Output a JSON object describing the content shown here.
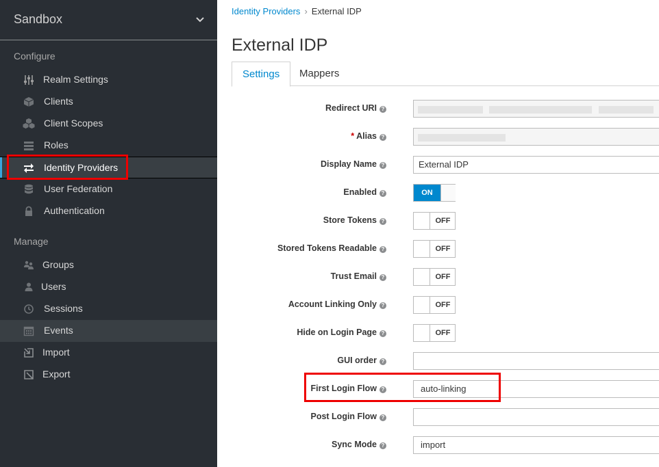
{
  "sidebar": {
    "realm": "Sandbox",
    "sections": {
      "configure": "Configure",
      "manage": "Manage"
    },
    "configure_items": [
      {
        "label": "Realm Settings",
        "icon": "sliders-icon"
      },
      {
        "label": "Clients",
        "icon": "cube-icon"
      },
      {
        "label": "Client Scopes",
        "icon": "cubes-icon"
      },
      {
        "label": "Roles",
        "icon": "list-icon"
      },
      {
        "label": "Identity Providers",
        "icon": "exchange-icon"
      },
      {
        "label": "User Federation",
        "icon": "database-icon"
      },
      {
        "label": "Authentication",
        "icon": "lock-icon"
      }
    ],
    "manage_items": [
      {
        "label": "Groups",
        "icon": "users-icon"
      },
      {
        "label": "Users",
        "icon": "user-icon"
      },
      {
        "label": "Sessions",
        "icon": "clock-icon"
      },
      {
        "label": "Events",
        "icon": "calendar-icon"
      },
      {
        "label": "Import",
        "icon": "import-icon"
      },
      {
        "label": "Export",
        "icon": "export-icon"
      }
    ],
    "active_item": "Identity Providers"
  },
  "breadcrumb": {
    "parent": "Identity Providers",
    "separator": "›",
    "current": "External IDP"
  },
  "page_title": "External IDP",
  "tabs": [
    {
      "label": "Settings",
      "active": true
    },
    {
      "label": "Mappers",
      "active": false
    }
  ],
  "form": {
    "redirect_uri": {
      "label": "Redirect URI"
    },
    "alias": {
      "label": "Alias",
      "required_mark": "*"
    },
    "display_name": {
      "label": "Display Name",
      "value": "External IDP"
    },
    "enabled": {
      "label": "Enabled",
      "state": "ON"
    },
    "store_tokens": {
      "label": "Store Tokens",
      "state": "OFF"
    },
    "stored_tokens_readable": {
      "label": "Stored Tokens Readable",
      "state": "OFF"
    },
    "trust_email": {
      "label": "Trust Email",
      "state": "OFF"
    },
    "account_linking_only": {
      "label": "Account Linking Only",
      "state": "OFF"
    },
    "hide_on_login_page": {
      "label": "Hide on Login Page",
      "state": "OFF"
    },
    "gui_order": {
      "label": "GUI order",
      "value": ""
    },
    "first_login_flow": {
      "label": "First Login Flow",
      "value": "auto-linking"
    },
    "post_login_flow": {
      "label": "Post Login Flow",
      "value": ""
    },
    "sync_mode": {
      "label": "Sync Mode",
      "value": "import"
    }
  },
  "colors": {
    "sidebar_bg": "#292e34",
    "accent": "#0088ce",
    "highlight_box": "#e00000"
  }
}
